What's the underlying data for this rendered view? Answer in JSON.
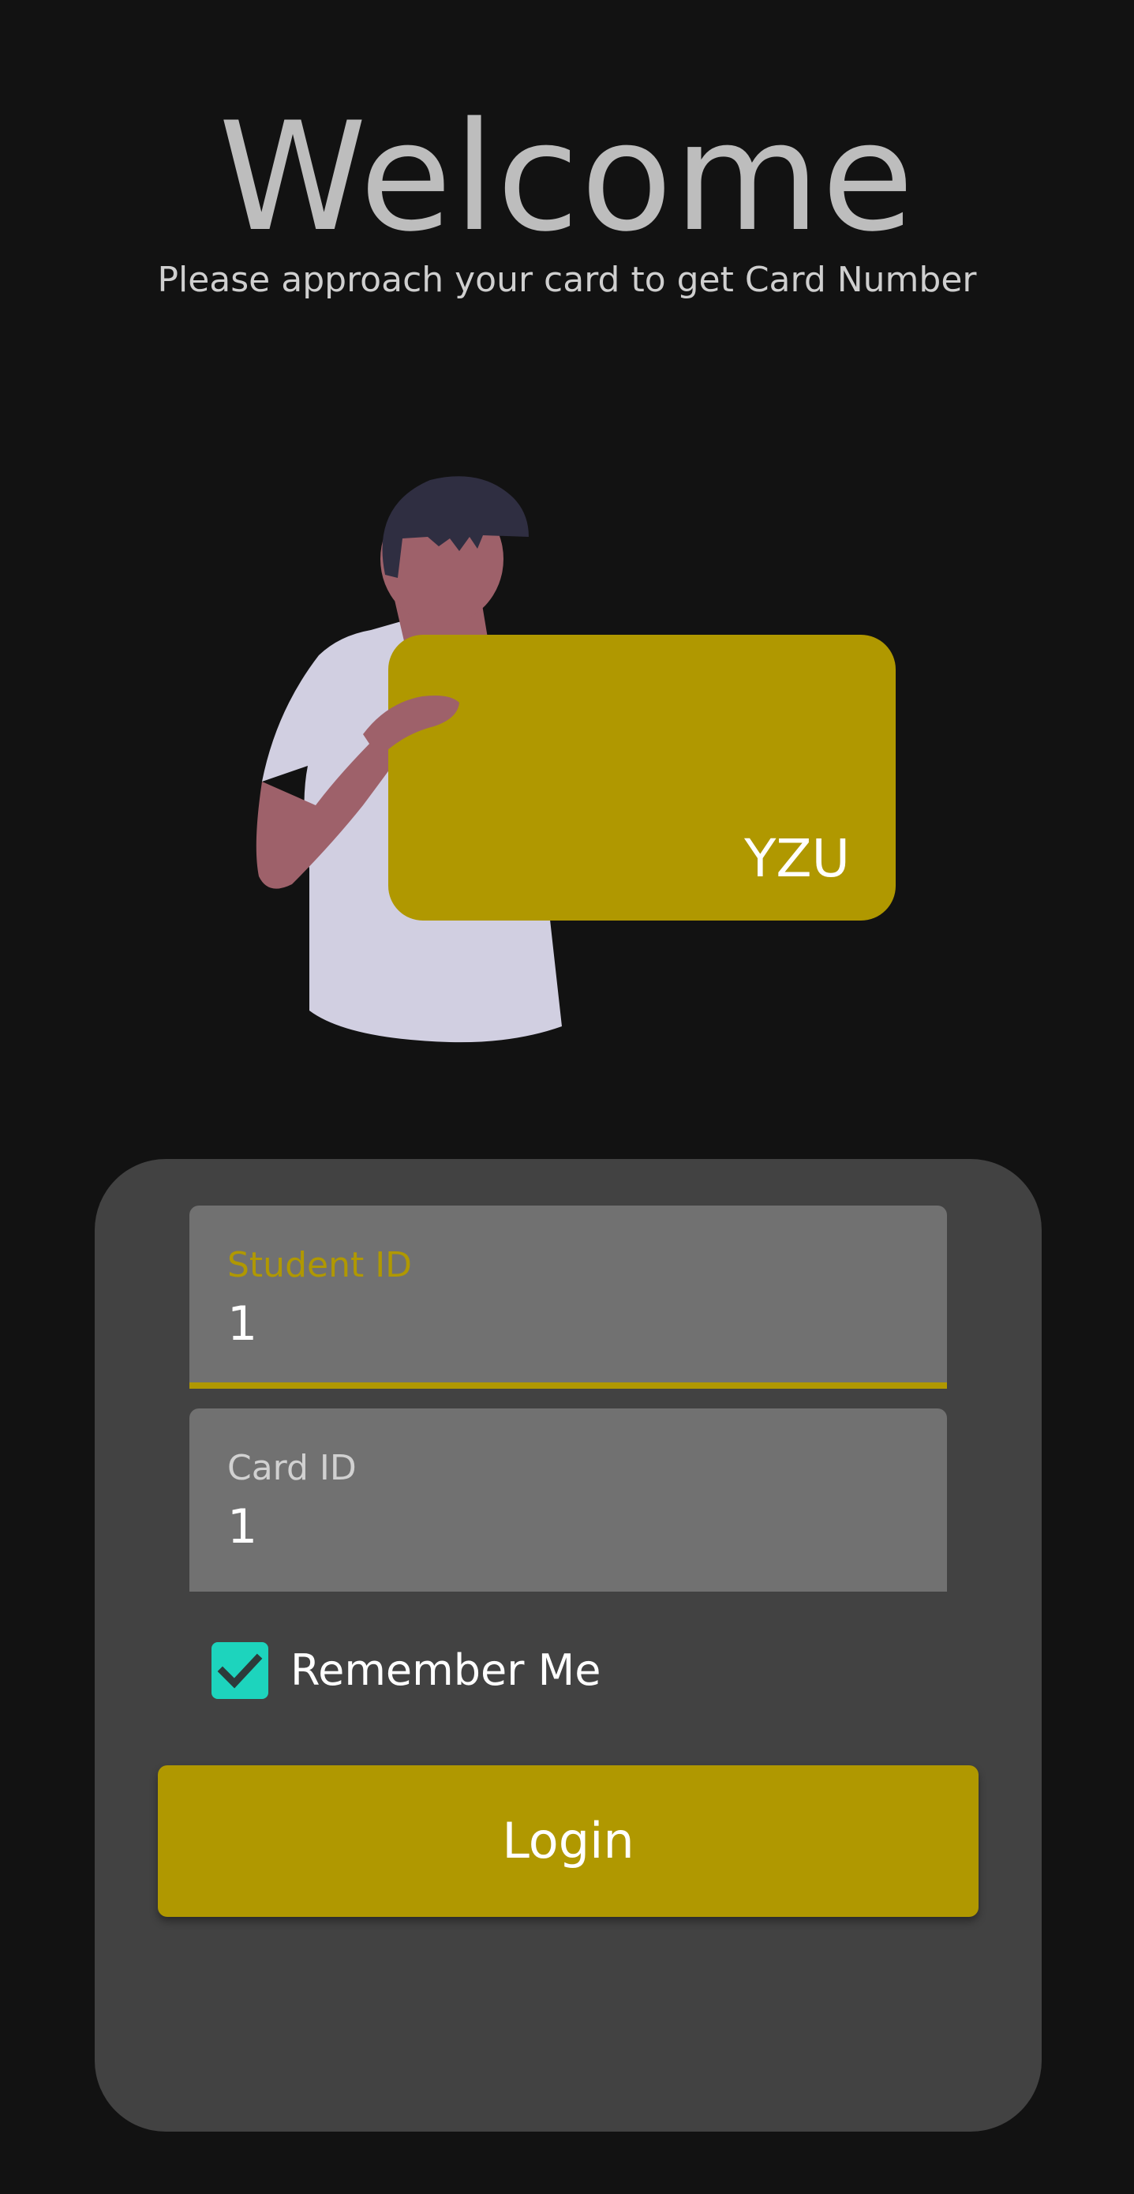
{
  "header": {
    "title": "Welcome",
    "subtitle": "Please approach your card to get Card Number"
  },
  "illustration": {
    "card_brand": "YZU"
  },
  "form": {
    "student_id": {
      "label": "Student ID",
      "value": "1"
    },
    "card_id": {
      "label": "Card ID",
      "value": "1"
    },
    "remember_me": {
      "label": "Remember Me",
      "checked": true
    },
    "login_label": "Login"
  },
  "colors": {
    "background": "#121212",
    "panel": "#424242",
    "field": "#717171",
    "accent": "#b09800",
    "checkbox": "#1dd4bd"
  }
}
